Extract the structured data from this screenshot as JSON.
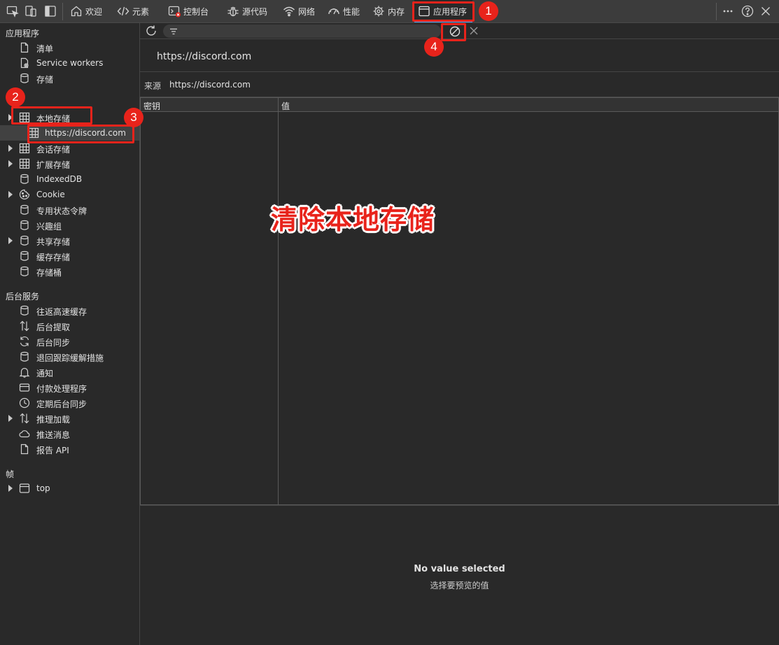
{
  "tabs": [
    {
      "label": "欢迎",
      "icon": "home-icon"
    },
    {
      "label": "元素",
      "icon": "code-icon"
    },
    {
      "label": "控制台",
      "icon": "console-icon"
    },
    {
      "label": "源代码",
      "icon": "bug-icon"
    },
    {
      "label": "网络",
      "icon": "wifi-icon"
    },
    {
      "label": "性能",
      "icon": "gauge-icon"
    },
    {
      "label": "内存",
      "icon": "chip-icon"
    },
    {
      "label": "应用程序",
      "icon": "window-icon",
      "active": true
    }
  ],
  "sidebar": {
    "app_section": "应用程序",
    "app_items": [
      {
        "label": "清单",
        "icon": "file-icon"
      },
      {
        "label": "Service workers",
        "icon": "service-worker-icon"
      },
      {
        "label": "存储",
        "icon": "database-icon"
      }
    ],
    "storage_items": [
      {
        "label": "本地存储",
        "icon": "table-icon",
        "expandable": true
      },
      {
        "label": "https://discord.com",
        "icon": "table-icon",
        "child": true,
        "selected": true
      },
      {
        "label": "会话存储",
        "icon": "table-icon",
        "expandable": true
      },
      {
        "label": "扩展存储",
        "icon": "table-icon",
        "expandable": true
      },
      {
        "label": "IndexedDB",
        "icon": "database-icon"
      },
      {
        "label": "Cookie",
        "icon": "cookie-icon",
        "expandable": true
      },
      {
        "label": "专用状态令牌",
        "icon": "database-icon"
      },
      {
        "label": "兴趣组",
        "icon": "database-icon"
      },
      {
        "label": "共享存储",
        "icon": "database-icon",
        "expandable": true
      },
      {
        "label": "缓存存储",
        "icon": "database-icon"
      },
      {
        "label": "存储桶",
        "icon": "database-icon"
      }
    ],
    "bg_section": "后台服务",
    "bg_items": [
      {
        "label": "往返高速缓存",
        "icon": "database-icon"
      },
      {
        "label": "后台提取",
        "icon": "arrows-updown-icon"
      },
      {
        "label": "后台同步",
        "icon": "sync-icon"
      },
      {
        "label": "退回跟踪缓解措施",
        "icon": "database-icon"
      },
      {
        "label": "通知",
        "icon": "bell-icon"
      },
      {
        "label": "付款处理程序",
        "icon": "card-icon"
      },
      {
        "label": "定期后台同步",
        "icon": "clock-icon"
      },
      {
        "label": "推理加载",
        "icon": "arrows-updown-icon",
        "expandable": true
      },
      {
        "label": "推送消息",
        "icon": "cloud-icon"
      },
      {
        "label": "报告 API",
        "icon": "file-icon"
      }
    ],
    "frames_section": "帧",
    "frames_items": [
      {
        "label": "top",
        "icon": "frame-icon",
        "expandable": true
      }
    ]
  },
  "main": {
    "filter_placeholder": "",
    "origin_title": "https://discord.com",
    "origin_label": "来源",
    "origin_value": "https://discord.com",
    "col_key": "密钥",
    "col_value": "值",
    "preview_title": "No value selected",
    "preview_subtitle": "选择要预览的值"
  },
  "annotations": {
    "badges": [
      "1",
      "2",
      "3",
      "4"
    ],
    "caption": "清除本地存储",
    "color": "#e8231b"
  },
  "colors": {
    "background": "#292929",
    "toolbar": "#3c3c3c",
    "accent": "#4fa3f7"
  }
}
